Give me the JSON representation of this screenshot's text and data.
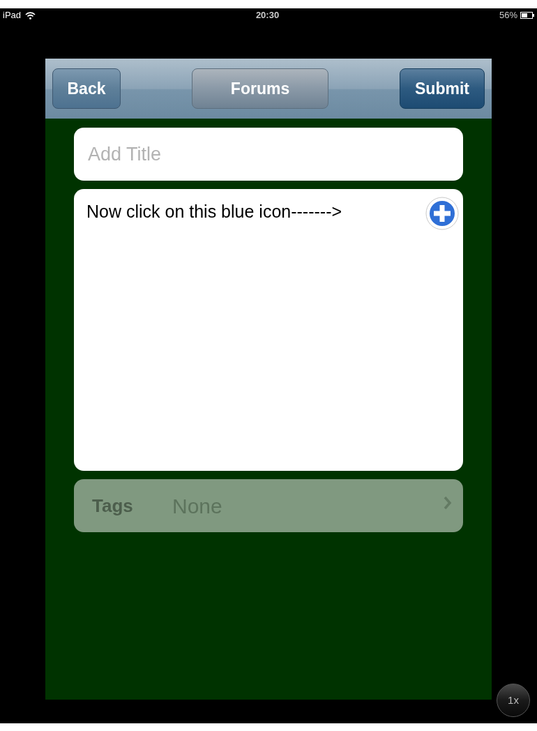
{
  "status_bar": {
    "device": "iPad",
    "time": "20:30",
    "battery": "56%"
  },
  "nav_bar": {
    "back": "Back",
    "title": "Forums",
    "submit": "Submit"
  },
  "title_field": {
    "placeholder": "Add Title"
  },
  "body_field": {
    "value": "Now click on this blue icon------->"
  },
  "tags_row": {
    "label": "Tags",
    "value": "None",
    "disabled": true
  },
  "zoom_button": {
    "label": "1x"
  }
}
